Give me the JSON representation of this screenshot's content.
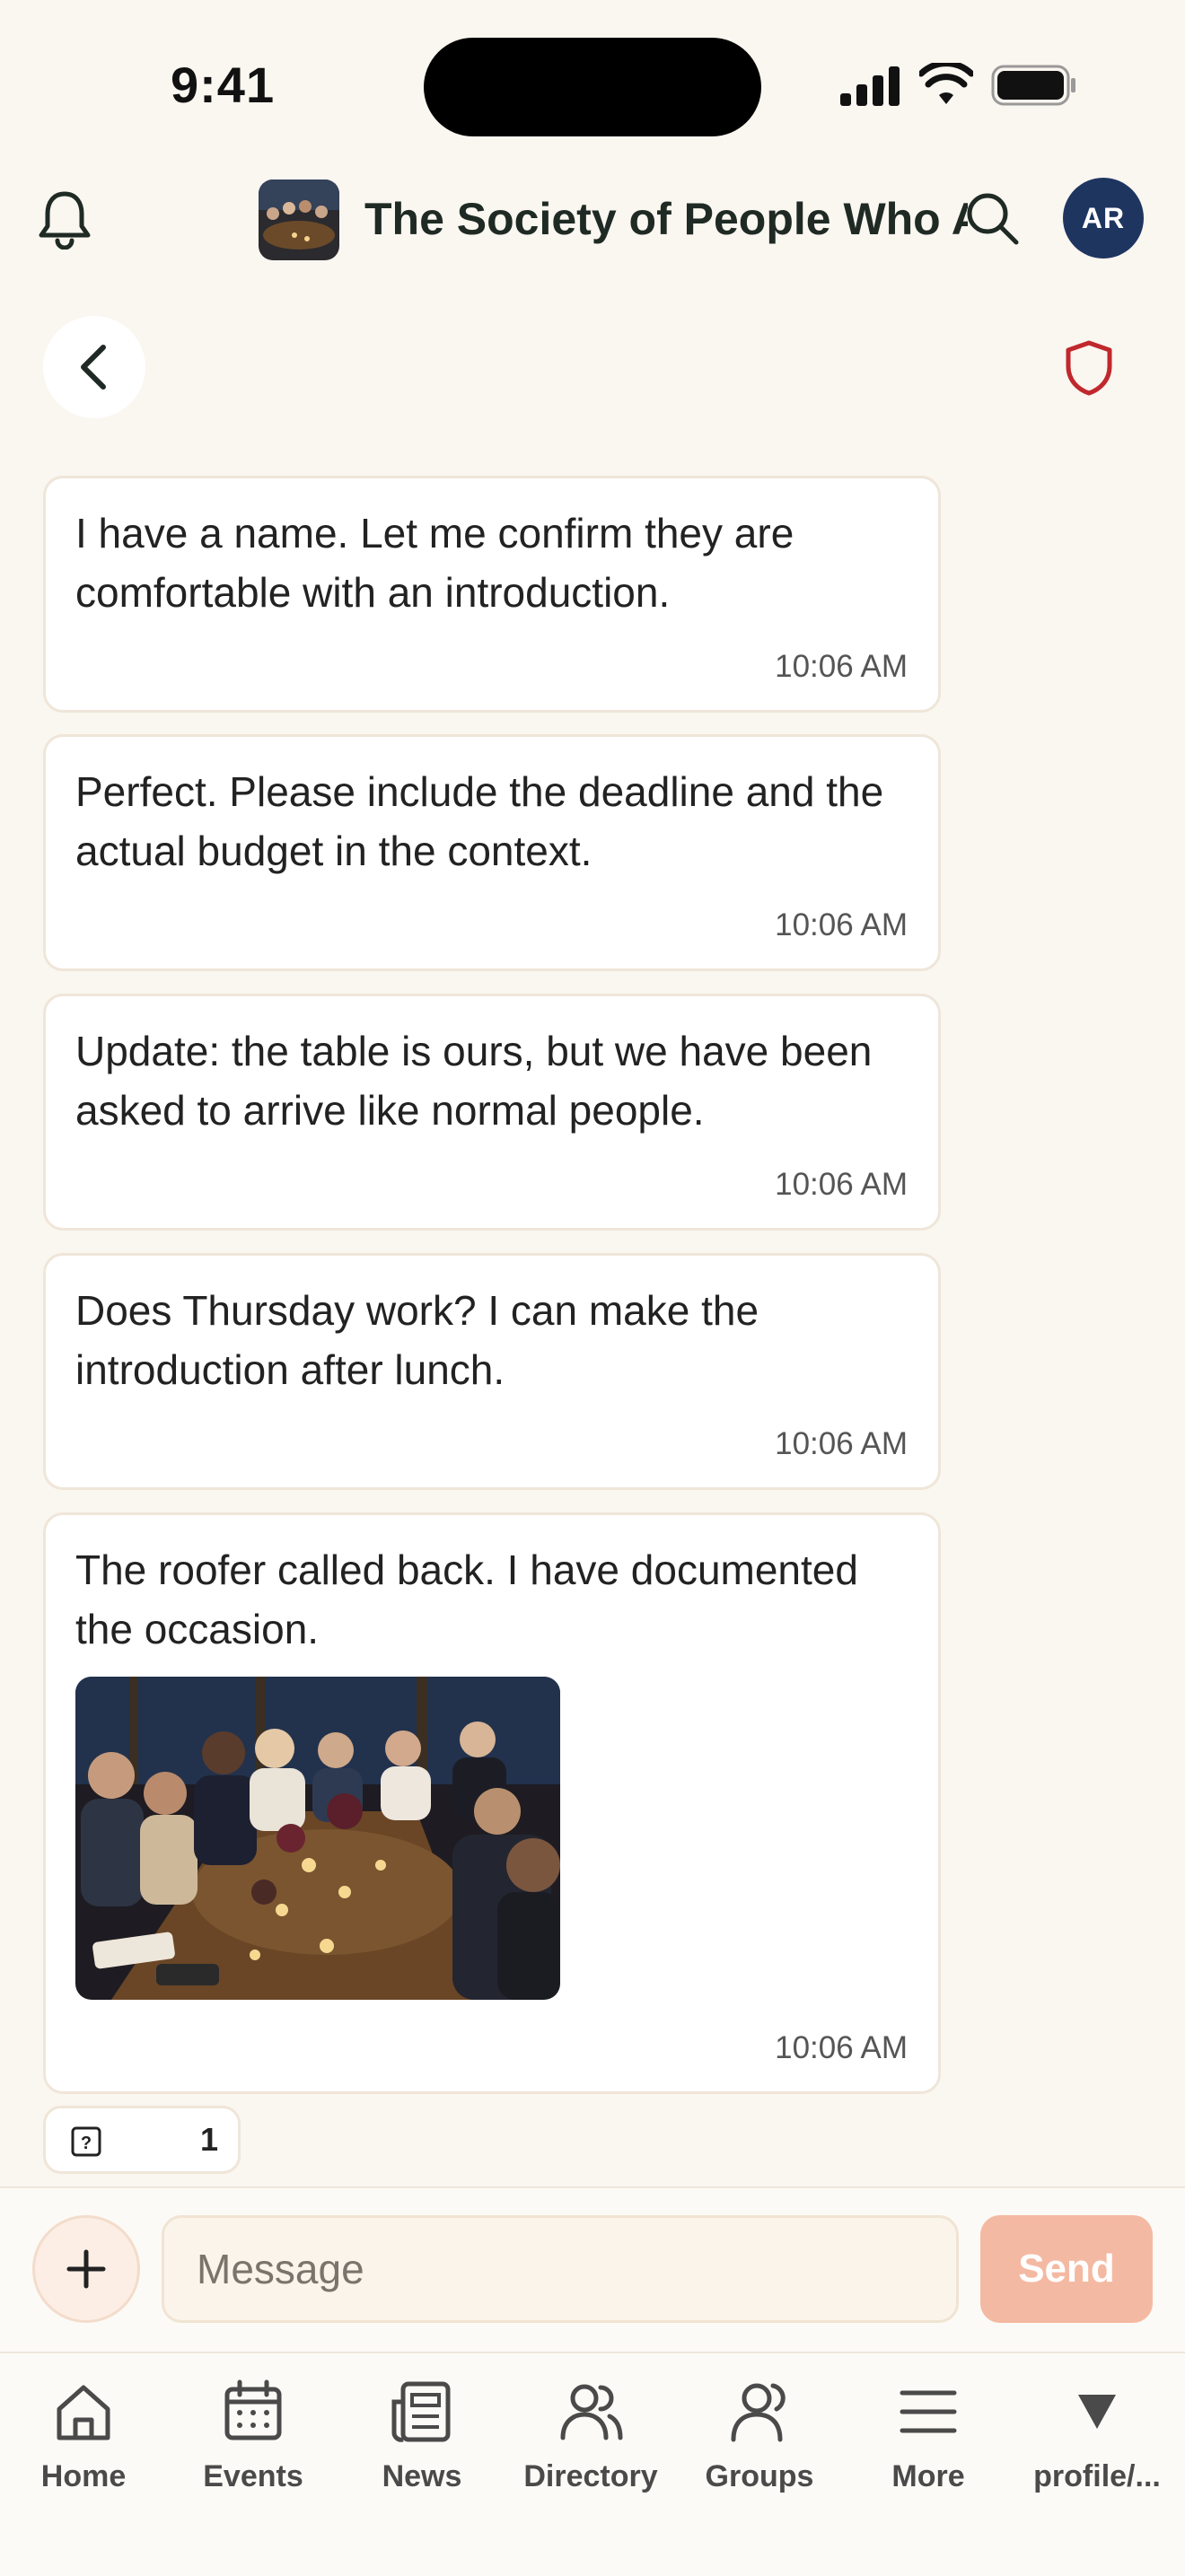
{
  "status_bar": {
    "time": "9:41"
  },
  "header": {
    "group_name": "The Society of People Who Are Very Good at Lunch",
    "avatar_initials": "AR"
  },
  "messages": [
    {
      "text": "I have a name. Let me confirm they are comfortable with an introduction.",
      "time": "10:06 AM"
    },
    {
      "text": "Perfect. Please include the deadline and the actual budget in the context.",
      "time": "10:06 AM"
    },
    {
      "text": "Update: the table is ours, but we have been asked to arrive like normal people.",
      "time": "10:06 AM"
    },
    {
      "text": "Does Thursday work? I can make the introduction after lunch.",
      "time": "10:06 AM"
    },
    {
      "text": "The roofer called back. I have documented the occasion.",
      "time": "10:06 AM",
      "has_photo": true
    }
  ],
  "reaction": {
    "count": "1"
  },
  "composer": {
    "placeholder": "Message",
    "send_label": "Send"
  },
  "tabs": [
    {
      "label": "Home",
      "icon": "home-icon"
    },
    {
      "label": "Events",
      "icon": "calendar-icon"
    },
    {
      "label": "News",
      "icon": "newspaper-icon"
    },
    {
      "label": "Directory",
      "icon": "people-icon"
    },
    {
      "label": "Groups",
      "icon": "group-icon"
    },
    {
      "label": "More",
      "icon": "menu-icon"
    },
    {
      "label": "profile/...",
      "icon": "triangle-down-icon"
    }
  ],
  "colors": {
    "background": "#FAF6F0",
    "avatar": "#1E3560",
    "shield": "#C0282D",
    "send_disabled": "#F4B9A2"
  }
}
